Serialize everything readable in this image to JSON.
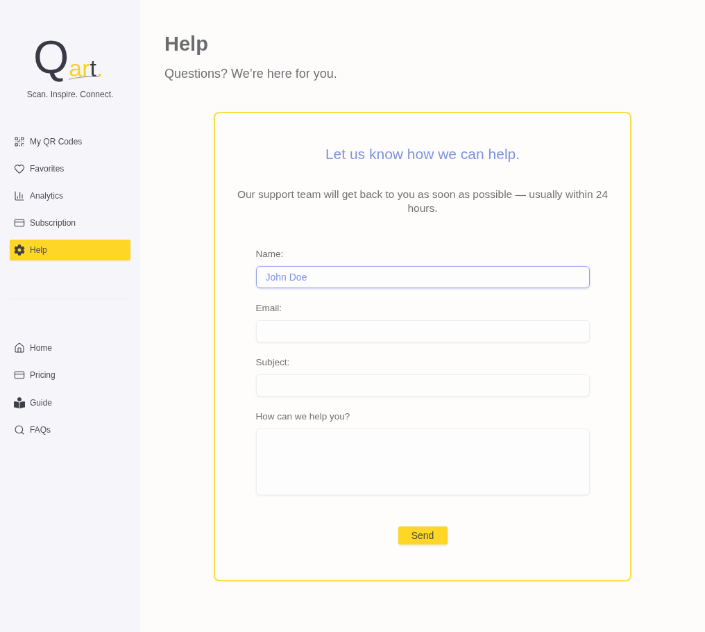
{
  "sidebar": {
    "logo": {
      "parts": [
        {
          "text": "Q",
          "kind": "initial"
        },
        {
          "text": "ar",
          "kind": "accent"
        },
        {
          "text": "t",
          "kind": "plain"
        },
        {
          "text": ".",
          "kind": "accent"
        }
      ]
    },
    "tagline": "Scan. Inspire. Connect.",
    "main_items": [
      {
        "label": "My QR Codes",
        "selected": false
      },
      {
        "label": "Favorites",
        "selected": false
      },
      {
        "label": "Analytics",
        "selected": false
      },
      {
        "label": "Subscription",
        "selected": false
      },
      {
        "label": "Help",
        "selected": true
      }
    ],
    "site_items": [
      {
        "label": "Home",
        "selected": false
      },
      {
        "label": "Pricing",
        "selected": false
      },
      {
        "label": "Guide",
        "selected": false
      },
      {
        "label": "FAQs",
        "selected": false
      }
    ]
  },
  "page": {
    "title": "Help",
    "subtitle": "Questions? We’re here for you."
  },
  "form": {
    "title": "Let us know how we can help.",
    "description": "Our support team will get back to you as soon as possible — usually within 24 hours.",
    "fields": [
      {
        "label": "Name:",
        "kind": "input",
        "value": "John Doe",
        "focused": true
      },
      {
        "label": "Email:",
        "kind": "input",
        "focused": false
      },
      {
        "label": "Subject:",
        "kind": "input",
        "focused": false
      },
      {
        "label": "How can we help you?",
        "kind": "textarea",
        "focused": false
      }
    ],
    "submit": "Send"
  }
}
